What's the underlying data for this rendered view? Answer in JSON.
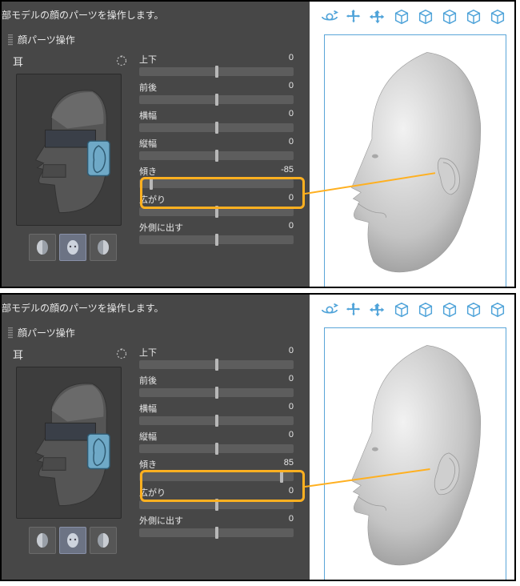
{
  "description": "部モデルの顔のパーツを操作します。",
  "section_title": "顔パーツ操作",
  "part_name": "耳",
  "sliders": [
    {
      "label": "上下",
      "value": 0,
      "pos": 50
    },
    {
      "label": "前後",
      "value": 0,
      "pos": 50
    },
    {
      "label": "横幅",
      "value": 0,
      "pos": 50
    },
    {
      "label": "縦幅",
      "value": 0,
      "pos": 50
    },
    {
      "label": "傾き",
      "value": -85,
      "pos": 8
    },
    {
      "label": "広がり",
      "value": 0,
      "pos": 50
    },
    {
      "label": "外側に出す",
      "value": 0,
      "pos": 50
    }
  ],
  "sliders_b": [
    {
      "label": "上下",
      "value": 0,
      "pos": 50
    },
    {
      "label": "前後",
      "value": 0,
      "pos": 50
    },
    {
      "label": "横幅",
      "value": 0,
      "pos": 50
    },
    {
      "label": "縦幅",
      "value": 0,
      "pos": 50
    },
    {
      "label": "傾き",
      "value": 85,
      "pos": 92
    },
    {
      "label": "広がり",
      "value": 0,
      "pos": 50
    },
    {
      "label": "外側に出す",
      "value": 0,
      "pos": 50
    }
  ],
  "highlighted_index": 4,
  "toolbar_icons": [
    "orbit-icon",
    "pan-icon",
    "zoom-icon",
    "cube1-icon",
    "cube2-icon",
    "cube3-icon",
    "cube4-icon",
    "cube5-icon"
  ],
  "selector_buttons": [
    "view-left",
    "view-front",
    "view-right"
  ],
  "selector_active_index": 1
}
